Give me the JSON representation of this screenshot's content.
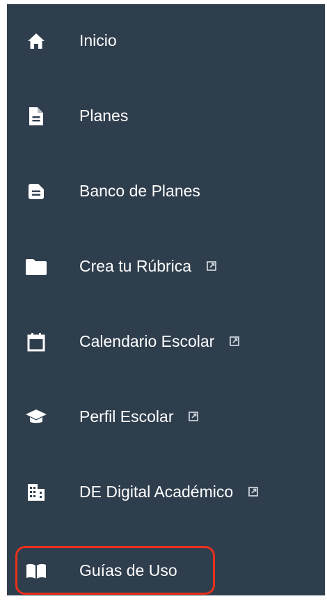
{
  "sidebar": {
    "items": [
      {
        "label": "Inicio",
        "icon": "home-icon",
        "external": false
      },
      {
        "label": "Planes",
        "icon": "document-icon",
        "external": false
      },
      {
        "label": "Banco de Planes",
        "icon": "document-icon",
        "external": false
      },
      {
        "label": "Crea tu Rúbrica",
        "icon": "folder-icon",
        "external": true
      },
      {
        "label": "Calendario Escolar",
        "icon": "calendar-icon",
        "external": true
      },
      {
        "label": "Perfil Escolar",
        "icon": "graduation-cap-icon",
        "external": true
      },
      {
        "label": "DE Digital Académico",
        "icon": "building-icon",
        "external": true
      },
      {
        "label": "Guías de Uso",
        "icon": "book-icon",
        "external": false,
        "highlighted": true
      }
    ]
  },
  "colors": {
    "sidebar_bg": "#2f3e4d",
    "text": "#ffffff",
    "highlight_border": "#e8301c"
  }
}
